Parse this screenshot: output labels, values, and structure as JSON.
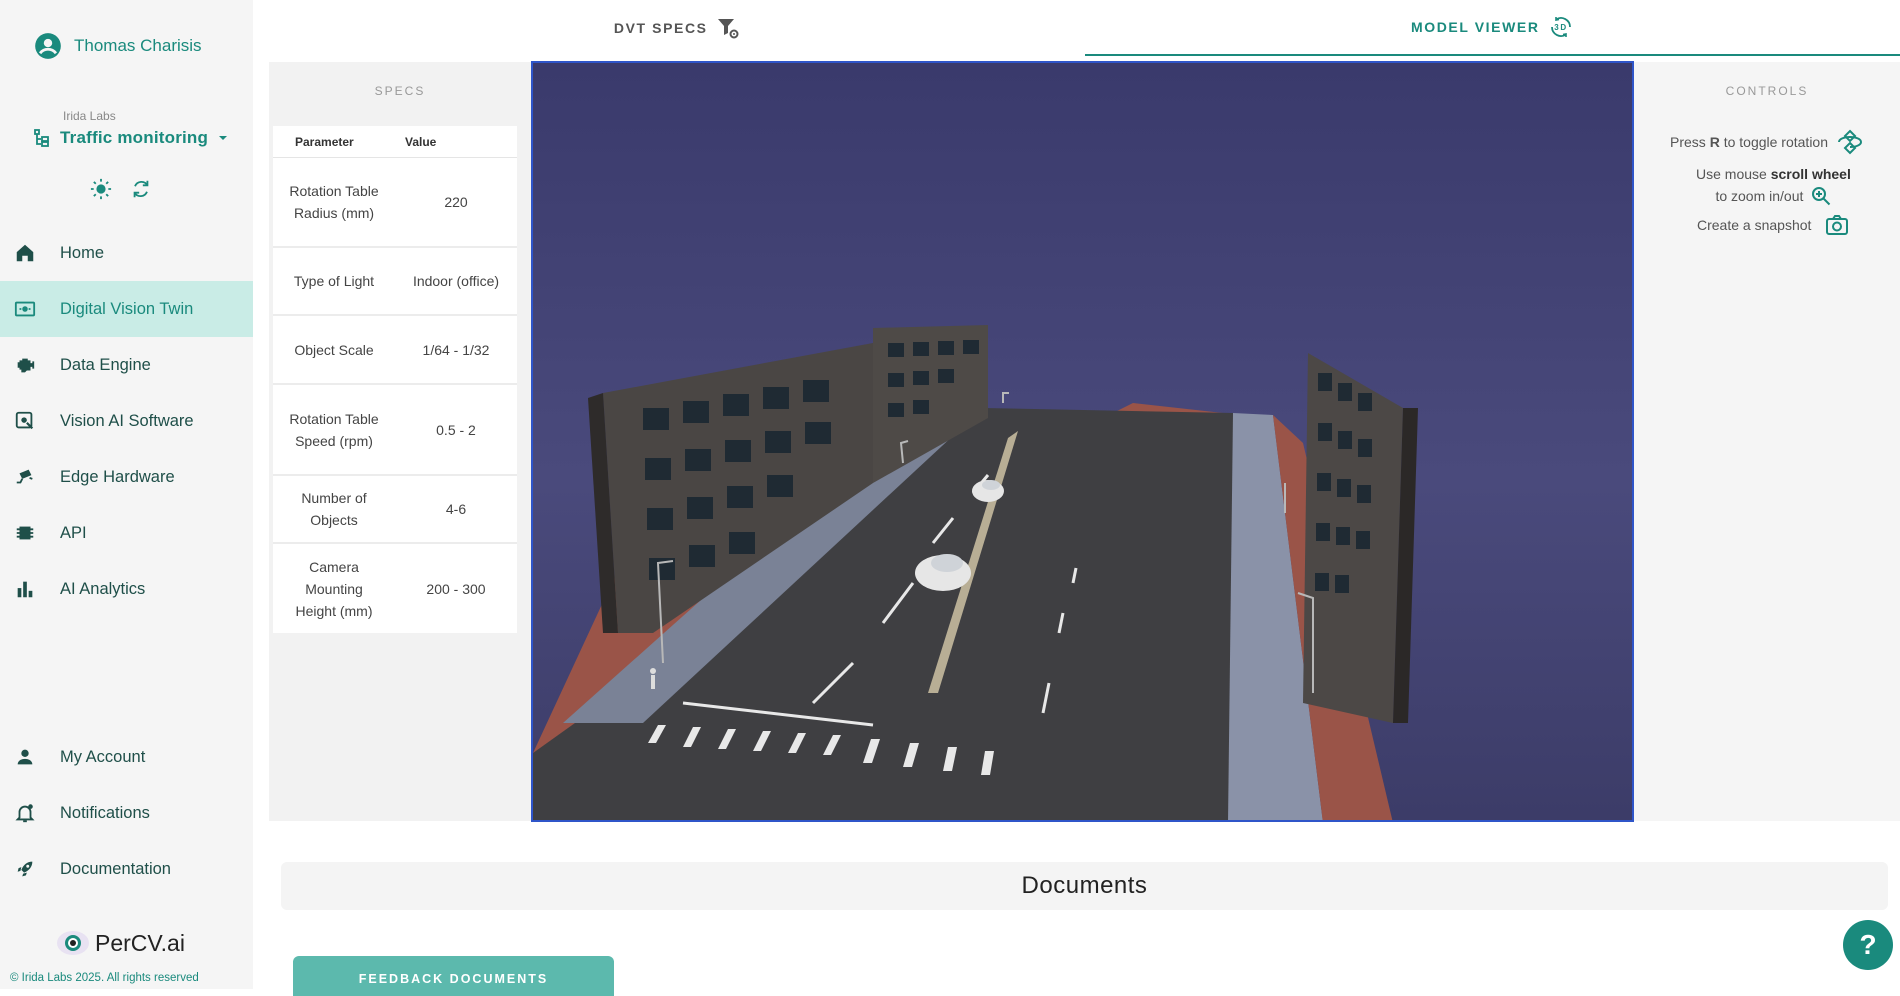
{
  "user": {
    "name": "Thomas Charisis"
  },
  "org": {
    "name": "Irida Labs"
  },
  "project": {
    "name": "Traffic monitoring"
  },
  "nav": {
    "items": [
      {
        "label": "Home"
      },
      {
        "label": "Digital Vision Twin"
      },
      {
        "label": "Data Engine"
      },
      {
        "label": "Vision AI Software"
      },
      {
        "label": "Edge Hardware"
      },
      {
        "label": "API"
      },
      {
        "label": "AI Analytics"
      }
    ],
    "bottom": [
      {
        "label": "My Account"
      },
      {
        "label": "Notifications"
      },
      {
        "label": "Documentation"
      }
    ]
  },
  "brand": {
    "logo_text": "PerCV.ai",
    "copyright": "© Irida Labs 2025. All rights reserved"
  },
  "tabs": [
    {
      "label": "DVT SPECS"
    },
    {
      "label": "MODEL VIEWER"
    }
  ],
  "specs": {
    "title": "SPECS",
    "headers": {
      "param": "Parameter",
      "value": "Value"
    },
    "rows": [
      {
        "param": "Rotation Table Radius (mm)",
        "value": "220"
      },
      {
        "param": "Type of Light",
        "value": "Indoor (office)"
      },
      {
        "param": "Object Scale",
        "value": "1/64 - 1/32"
      },
      {
        "param": "Rotation Table Speed (rpm)",
        "value": "0.5 - 2"
      },
      {
        "param": "Number of Objects",
        "value": "4-6"
      },
      {
        "param": "Camera Mounting Height (mm)",
        "value": "200 - 300"
      }
    ]
  },
  "controls": {
    "title": "CONTROLS",
    "rotate_pre": "Press ",
    "rotate_key": "R",
    "rotate_post": " to toggle rotation",
    "zoom_pre": "Use mouse ",
    "zoom_key": "scroll wheel",
    "zoom_post": "to zoom in/out",
    "snapshot": "Create a snapshot"
  },
  "documents": {
    "title": "Documents",
    "feedback_label": "FEEDBACK DOCUMENTS"
  },
  "help": {
    "label": "?"
  },
  "colors": {
    "accent": "#1a8a7d",
    "active_bg": "#c9ece6",
    "viewer_border": "#2f55c9"
  }
}
